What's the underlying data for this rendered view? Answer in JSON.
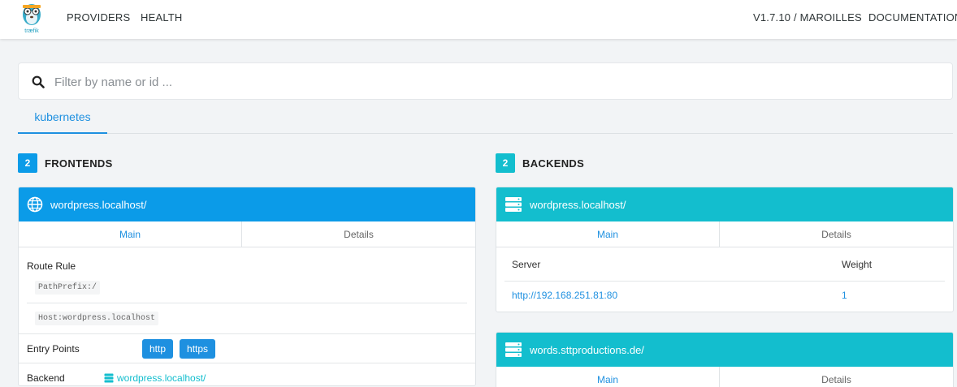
{
  "nav": {
    "logo_text": "træfik",
    "providers": "PROVIDERS",
    "health": "HEALTH",
    "version": "V1.7.10 / MAROILLES",
    "documentation": "DOCUMENTATION"
  },
  "search": {
    "placeholder": "Filter by name or id ..."
  },
  "provider_tab": "kubernetes",
  "frontends": {
    "count": "2",
    "title": "FRONTENDS",
    "header_color": "#0b9be8",
    "card": {
      "name": "wordpress.localhost/",
      "tabs": [
        "Main",
        "Details"
      ],
      "route_rule_label": "Route Rule",
      "rules": [
        "PathPrefix:/",
        "Host:wordpress.localhost"
      ],
      "entry_points_label": "Entry Points",
      "entry_points": [
        "http",
        "https"
      ],
      "backend_label": "Backend",
      "backend_value": "wordpress.localhost/"
    }
  },
  "backends": {
    "count": "2",
    "title": "BACKENDS",
    "header_color": "#13bece",
    "cards": [
      {
        "name": "wordpress.localhost/",
        "tabs": [
          "Main",
          "Details"
        ],
        "server_col": "Server",
        "weight_col": "Weight",
        "servers": [
          {
            "url": "http://192.168.251.81:80",
            "weight": "1"
          }
        ]
      },
      {
        "name": "words.sttproductions.de/",
        "tabs": [
          "Main",
          "Details"
        ]
      }
    ]
  },
  "colors": {
    "accent": "#1e90e0",
    "background": "#f2f4f6"
  }
}
